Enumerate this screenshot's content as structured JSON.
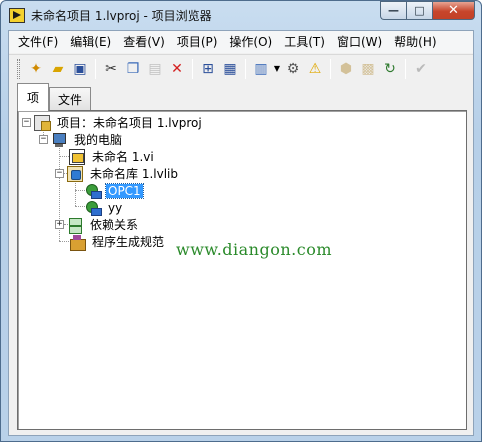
{
  "window": {
    "title": "未命名项目 1.lvproj - 项目浏览器",
    "controls": {
      "minimize": "—",
      "maximize": "□",
      "close": "✕"
    }
  },
  "menubar": {
    "items": [
      "文件(F)",
      "编辑(E)",
      "查看(V)",
      "项目(P)",
      "操作(O)",
      "工具(T)",
      "窗口(W)",
      "帮助(H)"
    ]
  },
  "toolbar": {
    "buttons": [
      {
        "icon": "new-icon",
        "glyph": "✦"
      },
      {
        "icon": "open-folder-icon",
        "glyph": "▰"
      },
      {
        "icon": "save-all-icon",
        "glyph": "▣"
      },
      {
        "icon": "cut-icon",
        "glyph": "✂"
      },
      {
        "icon": "copy-icon",
        "glyph": "❐"
      },
      {
        "icon": "paste-icon",
        "glyph": "▤"
      },
      {
        "icon": "delete-icon",
        "glyph": "✕"
      },
      {
        "icon": "add-to-project-icon",
        "glyph": "⊞"
      },
      {
        "icon": "save-project-icon",
        "glyph": "▦"
      },
      {
        "icon": "view-icon",
        "glyph": "▥"
      },
      {
        "icon": "settings-icon",
        "glyph": "⚙"
      },
      {
        "icon": "warning-icon",
        "glyph": "⚠"
      },
      {
        "icon": "deploy-icon",
        "glyph": "⬢"
      },
      {
        "icon": "build-icon",
        "glyph": "▩"
      },
      {
        "icon": "refresh-icon",
        "glyph": "↻"
      },
      {
        "icon": "check-icon",
        "glyph": "✔"
      }
    ]
  },
  "tabs": {
    "items": "项",
    "files": "文件"
  },
  "tree": {
    "project": "项目：未命名项目 1.lvproj",
    "my_computer": "我的电脑",
    "vi": "未命名 1.vi",
    "library": "未命名库 1.lvlib",
    "var1": "OPC1",
    "var2": "yy",
    "dependencies": "依赖关系",
    "build_specs": "程序生成规范",
    "expander_minus": "−",
    "expander_plus": "+"
  },
  "watermark": "www.diangon.com",
  "colors": {
    "selection": "#3399ff",
    "close_button": "#c7452b",
    "watermark": "#2a8a2a"
  }
}
